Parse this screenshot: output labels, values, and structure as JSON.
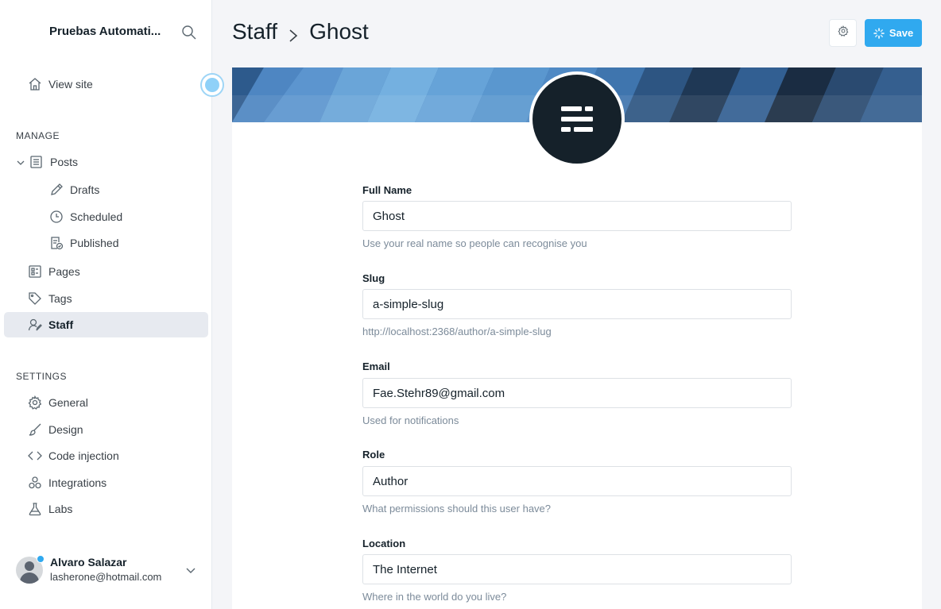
{
  "sidebar": {
    "site_title": "Pruebas Automati...",
    "view_site": "View site",
    "manage_label": "MANAGE",
    "settings_label": "SETTINGS",
    "posts": "Posts",
    "drafts": "Drafts",
    "scheduled": "Scheduled",
    "published": "Published",
    "pages": "Pages",
    "tags": "Tags",
    "staff": "Staff",
    "general": "General",
    "design": "Design",
    "code_injection": "Code injection",
    "integrations": "Integrations",
    "labs": "Labs",
    "user": {
      "name": "Alvaro Salazar",
      "email": "lasherone@hotmail.com"
    }
  },
  "header": {
    "breadcrumb_parent": "Staff",
    "breadcrumb_current": "Ghost",
    "save_label": "Save"
  },
  "form": {
    "full_name": {
      "label": "Full Name",
      "value": "Ghost",
      "hint": "Use your real name so people can recognise you"
    },
    "slug": {
      "label": "Slug",
      "value": "a-simple-slug",
      "hint": "http://localhost:2368/author/a-simple-slug"
    },
    "email": {
      "label": "Email",
      "value": "Fae.Stehr89@gmail.com",
      "hint": "Used for notifications"
    },
    "role": {
      "label": "Role",
      "value": "Author",
      "hint": "What permissions should this user have?"
    },
    "location": {
      "label": "Location",
      "value": "The Internet",
      "hint": "Where in the world do you live?"
    }
  },
  "colors": {
    "accent": "#30a9ef",
    "active_nav_bg": "#e7eaf0",
    "text_dark": "#15212a",
    "hint": "#7c8b9a"
  }
}
